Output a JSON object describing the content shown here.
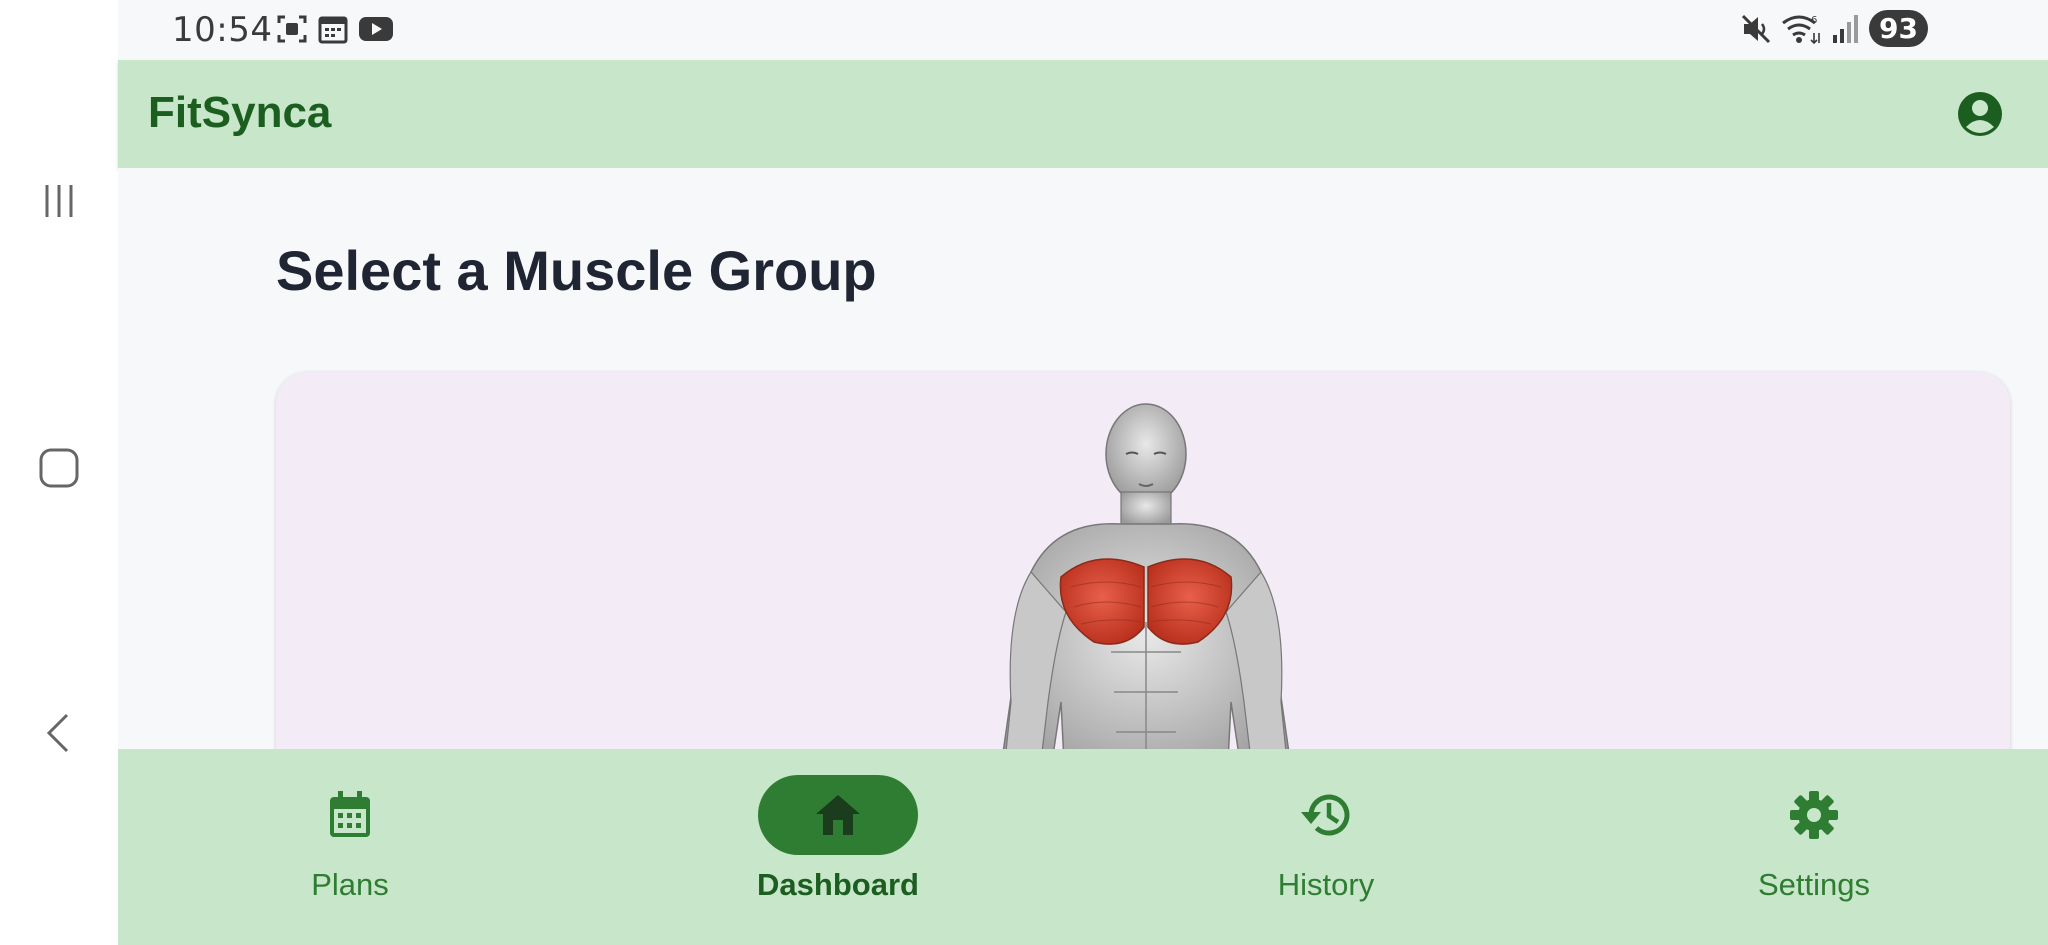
{
  "status_bar": {
    "time": "10:54",
    "battery": "93",
    "left_icons": [
      "screenshot-icon",
      "calendar-icon",
      "youtube-icon"
    ],
    "right_icons": [
      "mute-icon",
      "wifi-icon",
      "signal-icon"
    ]
  },
  "app_bar": {
    "title": "FitSynca",
    "profile_icon": "account-circle-icon"
  },
  "main": {
    "title": "Select a Muscle Group",
    "highlighted_muscle_color": "#d9452c"
  },
  "bottom_nav": {
    "items": [
      {
        "label": "Plans",
        "icon": "calendar-icon",
        "active": false
      },
      {
        "label": "Dashboard",
        "icon": "home-icon",
        "active": true
      },
      {
        "label": "History",
        "icon": "history-icon",
        "active": false
      },
      {
        "label": "Settings",
        "icon": "gear-icon",
        "active": false
      }
    ]
  },
  "colors": {
    "app_bar_bg": "#c8e6c9",
    "primary": "#2e7d32",
    "title_text": "#1b5e20",
    "card_bg": "#f3ecf6"
  }
}
